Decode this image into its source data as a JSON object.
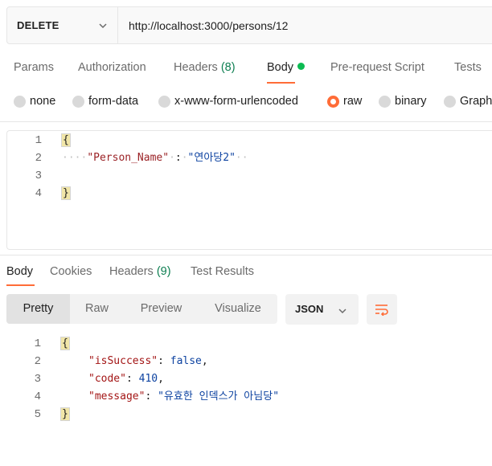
{
  "request": {
    "method": "DELETE",
    "url": "http://localhost:3000/persons/12"
  },
  "request_tabs": [
    {
      "label": "Params",
      "count": ""
    },
    {
      "label": "Authorization",
      "count": ""
    },
    {
      "label": "Headers",
      "count": "(8)"
    },
    {
      "label": "Body",
      "count": ""
    },
    {
      "label": "Pre-request Script",
      "count": ""
    },
    {
      "label": "Tests",
      "count": ""
    }
  ],
  "body_types": [
    "none",
    "form-data",
    "x-www-form-urlencoded",
    "raw",
    "binary",
    "GraphQL"
  ],
  "selected_body_type": "raw",
  "request_body": {
    "line_numbers": [
      "1",
      "2",
      "3",
      "4"
    ],
    "open_brace": "{",
    "close_brace": "}",
    "indent_dots": "····",
    "key": "\"Person_Name\"",
    "colon": ":",
    "value": "\"연아당2\"",
    "trailing": "··"
  },
  "response_tabs": [
    {
      "label": "Body",
      "count": ""
    },
    {
      "label": "Cookies",
      "count": ""
    },
    {
      "label": "Headers",
      "count": "(9)"
    },
    {
      "label": "Test Results",
      "count": ""
    }
  ],
  "view_modes": [
    "Pretty",
    "Raw",
    "Preview",
    "Visualize"
  ],
  "format": "JSON",
  "response_body": {
    "line_numbers": [
      "1",
      "2",
      "3",
      "4",
      "5"
    ],
    "open_brace": "{",
    "close_brace": "}",
    "lines": [
      {
        "key": "\"isSuccess\"",
        "sep": ": ",
        "value": "false",
        "end": ","
      },
      {
        "key": "\"code\"",
        "sep": ": ",
        "value": "410",
        "end": ","
      },
      {
        "key": "\"message\"",
        "sep": ": ",
        "value": "\"유효한 인덱스가 아님당\"",
        "end": ""
      }
    ]
  },
  "colors": {
    "accent": "#ff6c37",
    "status_dot": "#0cbb52",
    "count_green": "#0c7e50",
    "json_key": "#a31515",
    "json_value": "#0e43a1"
  },
  "icons": {
    "method_dropdown": "chevron-down-icon",
    "format_dropdown": "chevron-down-icon",
    "wrap": "wrap-lines-icon"
  }
}
